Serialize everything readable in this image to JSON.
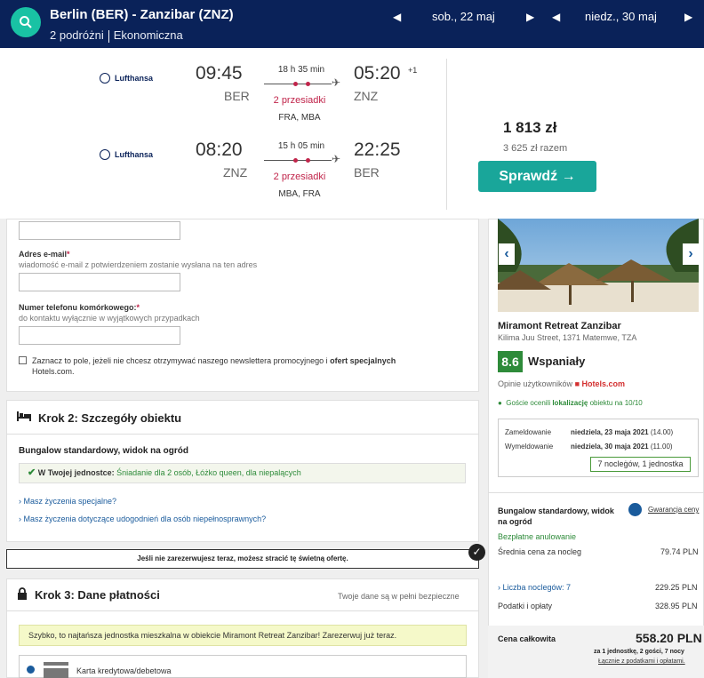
{
  "topbar": {
    "route": "Berlin (BER) - Zanzibar (ZNZ)",
    "travelers": "2 podróżni",
    "cabin": "Ekonomiczna",
    "depart_date": "sob., 22 maj",
    "return_date": "niedz., 30 maj"
  },
  "flights": [
    {
      "airline": "Lufthansa",
      "dep_time": "09:45",
      "dep_code": "BER",
      "arr_time": "05:20",
      "day_offset": "+1",
      "arr_code": "ZNZ",
      "duration": "18 h 35 min",
      "stops": "2 przesiadki",
      "via": "FRA, MBA"
    },
    {
      "airline": "Lufthansa",
      "dep_time": "08:20",
      "dep_code": "ZNZ",
      "arr_time": "22:25",
      "day_offset": "",
      "arr_code": "BER",
      "duration": "15 h 05 min",
      "stops": "2 przesiadki",
      "via": "MBA, FRA"
    }
  ],
  "offer": {
    "price": "1 813 zł",
    "total": "3 625 zł razem",
    "button": "Sprawdź →"
  },
  "form": {
    "email_label": "Adres e-mail",
    "req": "*",
    "email_hint": "wiadomość e-mail z potwierdzeniem zostanie wysłana na ten adres",
    "phone_label": "Numer telefonu komórkowego:",
    "phone_hint": "do kontaktu wyłącznie w wyjątkowych przypadkach",
    "newsletter_text": "Zaznacz to pole, jeżeli nie chcesz otrzymywać naszego newslettera promocyjnego i ",
    "newsletter_bold": "ofert specjalnych",
    "newsletter_tail": "Hotels.com."
  },
  "step2": {
    "title": "Krok 2: Szczegóły obiektu",
    "room": "Bungalow standardowy, widok na ogród",
    "unit_label": "W Twojej jednostce:",
    "unit_value": "Śniadanie dla 2 osób, Łóżko queen, dla niepalących",
    "link1": "Masz życzenia specjalne?",
    "link2": "Masz życzenia dotyczące udogodnień dla osób niepełnosprawnych?"
  },
  "warning": "Jeśli nie zarezerwujesz teraz, możesz stracić tę świetną ofertę.",
  "step3": {
    "title": "Krok 3: Dane płatności",
    "secure": "Twoje dane są w pełni bezpieczne",
    "notice": "Szybko, to najtańsza jednostka mieszkalna w obiekcie Miramont Retreat Zanzibar! Zarezerwuj już teraz.",
    "card": "Karta kredytowa/debetowa"
  },
  "hotel": {
    "name": "Miramont Retreat Zanzibar",
    "address": "Kilima Juu Street, 1371 Matemwe, TZA",
    "score": "8.6",
    "score_label": "Wspaniały",
    "reviews_label": "Opinie użytkowników",
    "reviews_brand": "Hotels.com",
    "guests_praise_pre": "Goście ocenili ",
    "guests_praise_bold": "lokalizację",
    "guests_praise_post": " obiektu na 10/10",
    "checkin_label": "Zameldowanie",
    "checkin_value": "niedziela, 23 maja 2021",
    "checkin_time": "(14.00)",
    "checkout_label": "Wymeldowanie",
    "checkout_value": "niedziela, 30 maja 2021",
    "checkout_time": "(11.00)",
    "nights": "7 nocleġów, 1 jednostka",
    "room": "Bungalow standardowy, widok na ogród",
    "guarantee": "Gwarancja ceny",
    "free_cancel": "Bezpłatne anulowanie",
    "avg_label": "Średnia cena za nocleg",
    "avg_value": "79.74 PLN",
    "nights_label": "Liczba noclegów: 7",
    "nights_value": "229.25 PLN",
    "taxes_label": "Podatki i opłaty",
    "taxes_value": "328.95 PLN",
    "total_label": "Cena całkowita",
    "total_value": "558.20 PLN",
    "total_note": "za 1 jednostkę, 2 gości, 7 nocy",
    "total_note2": "Łącznie z podatkami i opłatami."
  }
}
